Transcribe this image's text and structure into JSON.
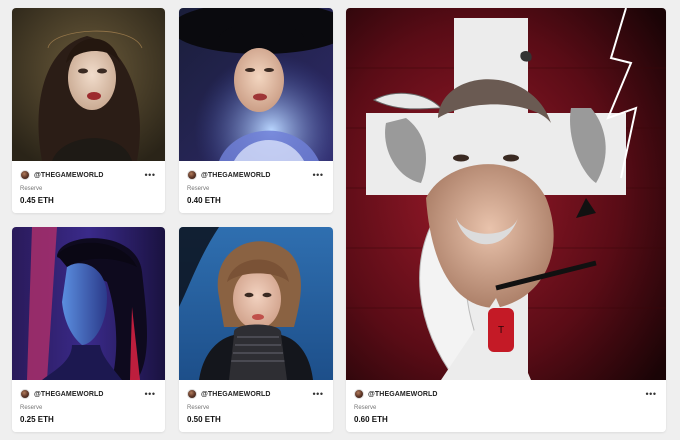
{
  "cards": [
    {
      "creator": "@THEGAMEWORLD",
      "reserve_label": "Reserve",
      "price": "0.45 ETH",
      "artwork": "portrait-woman-dark-hair-sepia"
    },
    {
      "creator": "@THEGAMEWORLD",
      "reserve_label": "Reserve",
      "price": "0.40 ETH",
      "artwork": "portrait-woman-black-hat-blue"
    },
    {
      "creator": "@THEGAMEWORLD",
      "reserve_label": "Reserve",
      "price": "0.25 ETH",
      "artwork": "portrait-woman-profile-purple"
    },
    {
      "creator": "@THEGAMEWORLD",
      "reserve_label": "Reserve",
      "price": "0.50 ETH",
      "artwork": "portrait-woman-bob-turtleneck"
    },
    {
      "creator": "@THEGAMEWORLD",
      "reserve_label": "Reserve",
      "price": "0.60 ETH",
      "artwork": "portrait-man-cross-red"
    }
  ],
  "more_icon": "ellipsis-icon"
}
